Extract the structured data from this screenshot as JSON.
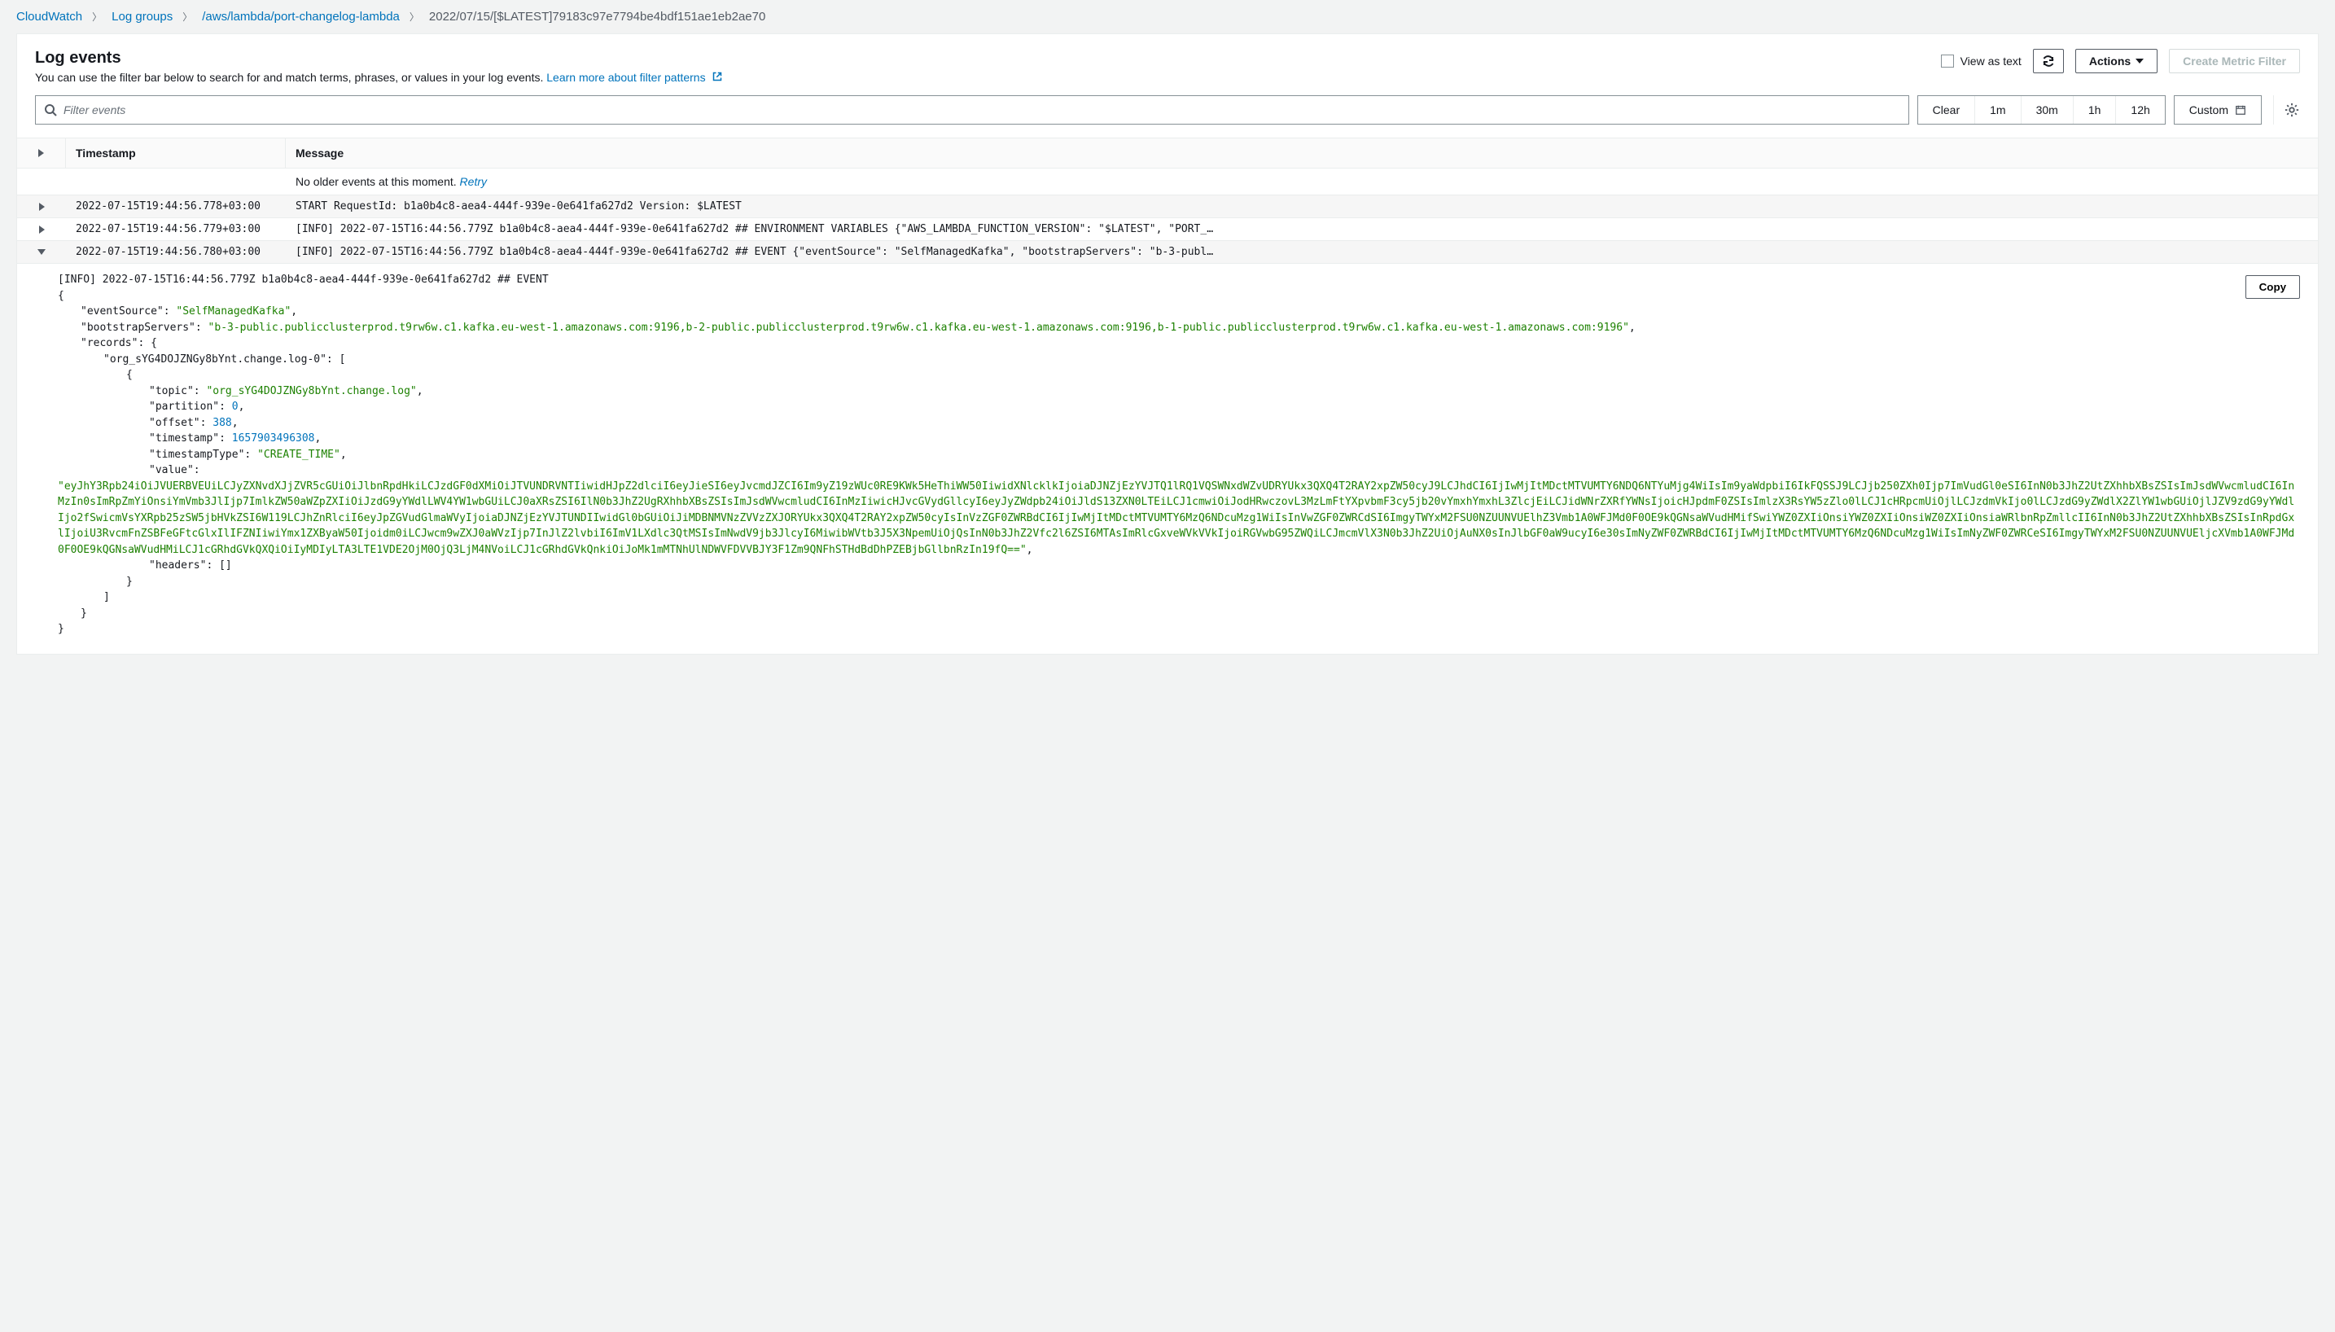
{
  "breadcrumb": {
    "root": "CloudWatch",
    "groups": "Log groups",
    "stream_group": "/aws/lambda/port-changelog-lambda",
    "current": "2022/07/15/[$LATEST]79183c97e7794be4bdf151ae1eb2ae70"
  },
  "header": {
    "title": "Log events",
    "subtitle": "You can use the filter bar below to search for and match terms, phrases, or values in your log events.",
    "learn_more": "Learn more about filter patterns",
    "view_as_text": "View as text",
    "actions": "Actions",
    "create_filter": "Create Metric Filter"
  },
  "filter": {
    "placeholder": "Filter events",
    "clear": "Clear",
    "m1": "1m",
    "m30": "30m",
    "h1": "1h",
    "h12": "12h",
    "custom": "Custom"
  },
  "columns": {
    "ts": "Timestamp",
    "msg": "Message"
  },
  "status": {
    "no_older": "No older events at this moment.",
    "retry": "Retry"
  },
  "rows": [
    {
      "ts": "2022-07-15T19:44:56.778+03:00",
      "msg": "START RequestId: b1a0b4c8-aea4-444f-939e-0e641fa627d2 Version: $LATEST"
    },
    {
      "ts": "2022-07-15T19:44:56.779+03:00",
      "msg": "[INFO] 2022-07-15T16:44:56.779Z b1a0b4c8-aea4-444f-939e-0e641fa627d2 ## ENVIRONMENT VARIABLES {\"AWS_LAMBDA_FUNCTION_VERSION\": \"$LATEST\", \"PORT_…"
    },
    {
      "ts": "2022-07-15T19:44:56.780+03:00",
      "msg": "[INFO] 2022-07-15T16:44:56.779Z b1a0b4c8-aea4-444f-939e-0e641fa627d2 ## EVENT {\"eventSource\": \"SelfManagedKafka\", \"bootstrapServers\": \"b-3-publ…"
    }
  ],
  "expanded": {
    "copy": "Copy",
    "heading": "[INFO]  2022-07-15T16:44:56.779Z       b1a0b4c8-aea4-444f-939e-0e641fa627d2    ## EVENT",
    "eventSource_key": "\"eventSource\":",
    "eventSource_val": "\"SelfManagedKafka\"",
    "bootstrap_key": "\"bootstrapServers\":",
    "bootstrap_val": "\"b-3-public.publicclusterprod.t9rw6w.c1.kafka.eu-west-1.amazonaws.com:9196,b-2-public.publicclusterprod.t9rw6w.c1.kafka.eu-west-1.amazonaws.com:9196,b-1-public.publicclusterprod.t9rw6w.c1.kafka.eu-west-1.amazonaws.com:9196\"",
    "records_key": "\"records\":",
    "topicArr_key": "\"org_sYG4DOJZNGy8bYnt.change.log-0\":",
    "topic_key": "\"topic\":",
    "topic_val": "\"org_sYG4DOJZNGy8bYnt.change.log\"",
    "partition_key": "\"partition\":",
    "partition_val": "0",
    "offset_key": "\"offset\":",
    "offset_val": "388",
    "timestamp_key": "\"timestamp\":",
    "timestamp_val": "1657903496308",
    "tsType_key": "\"timestampType\":",
    "tsType_val": "\"CREATE_TIME\"",
    "value_key": "\"value\":",
    "value_val": "\"eyJhY3Rpb24iOiJVUERBVEUiLCJyZXNvdXJjZVR5cGUiOiJlbnRpdHkiLCJzdGF0dXMiOiJTVUNDRVNTIiwidHJpZ2dlciI6eyJieSI6eyJvcmdJZCI6Im9yZ19zWUc0RE9KWk5HeThiWW50IiwidXNlcklkIjoiaDJNZjEzYVJTQ1lRQ1VQSWNxdWZvUDRYUkx3QXQ4T2RAY2xpZW50cyJ9LCJhdCI6IjIwMjItMDctMTVUMTY6NDQ6NTYuMjg4WiIsIm9yaWdpbiI6IkFQSSJ9LCJjb250ZXh0Ijp7ImVudGl0eSI6InN0b3JhZ2UtZXhhbXBsZSIsImJsdWVwcmludCI6InMzIn0sImRpZmYiOnsiYmVmb3JlIjp7ImlkZW50aWZpZXIiOiJzdG9yYWdlLWV4YW1wbGUiLCJ0aXRsZSI6IlN0b3JhZ2UgRXhhbXBsZSIsImJsdWVwcmludCI6InMzIiwicHJvcGVydGllcyI6eyJyZWdpb24iOiJldS13ZXN0LTEiLCJ1cmwiOiJodHRwczovL3MzLmFtYXpvbmF3cy5jb20vYmxhYmxhL3ZlcjEiLCJidWNrZXRfYWNsIjoicHJpdmF0ZSIsImlzX3RsYW5zZlo0lLCJ1cHRpcmUiOjlLCJzdmVkIjo0lLCJzdG9yZWdlX2ZlYW1wbGUiOjlJZV9zdG9yYWdlIjo2fSwicmVsYXRpb25zSW5jbHVkZSI6W119LCJhZnRlciI6eyJpZGVudGlmaWVyIjoiaDJNZjEzYVJTUNDIIwidGl0bGUiOiJiMDBNMVNzZVVzZXJORYUkx3QXQ4T2RAY2xpZW50cyIsInVzZGF0ZWRBdCI6IjIwMjItMDctMTVUMTY6MzQ6NDcuMzg1WiIsInVwZGF0ZWRCdSI6ImgyTWYxM2FSU0NZUUNVUElhZ3Vmb1A0WFJMd0F0OE9kQGNsaWVudHMifSwiYWZ0ZXIiOnsiYWZ0ZXIiOnsiWZ0ZXIiOnsiaWRlbnRpZmllcII6InN0b3JhZ2UtZXhhbXBsZSIsInRpdGxlIjoiU3RvcmFnZSBFeGFtcGlxIlIFZNIiwiYmx1ZXByaW50Ijoidm0iLCJwcm9wZXJ0aWVzIjp7InJlZ2lvbiI6ImV1LXdlc3QtMSIsImNwdV9jb3JlcyI6MiwibWVtb3J5X3NpemUiOjQsInN0b3JhZ2Vfc2l6ZSI6MTAsImRlcGxveWVkVVkIjoiRGVwbG95ZWQiLCJmcmVlX3N0b3JhZ2UiOjAuNX0sInJlbGF0aW9ucyI6e30sImNyZWF0ZWRBdCI6IjIwMjItMDctMTVUMTY6MzQ6NDcuMzg1WiIsImNyZWF0ZWRCeSI6ImgyTWYxM2FSU0NZUUNVUEljcXVmb1A0WFJMd0F0OE9kQGNsaWVudHMiLCJ1cGRhdGVkQXQiOiIyMDIyLTA3LTE1VDE2OjM0OjQ3LjM4NVoiLCJ1cGRhdGVkQnkiOiJoMk1mMTNhUlNDWVFDVVBJY3F1Zm9QNFhSTHdBdDhPZEBjbGllbnRzIn19fQ==\"",
    "headers_key": "\"headers\":",
    "headers_val": "[]"
  }
}
